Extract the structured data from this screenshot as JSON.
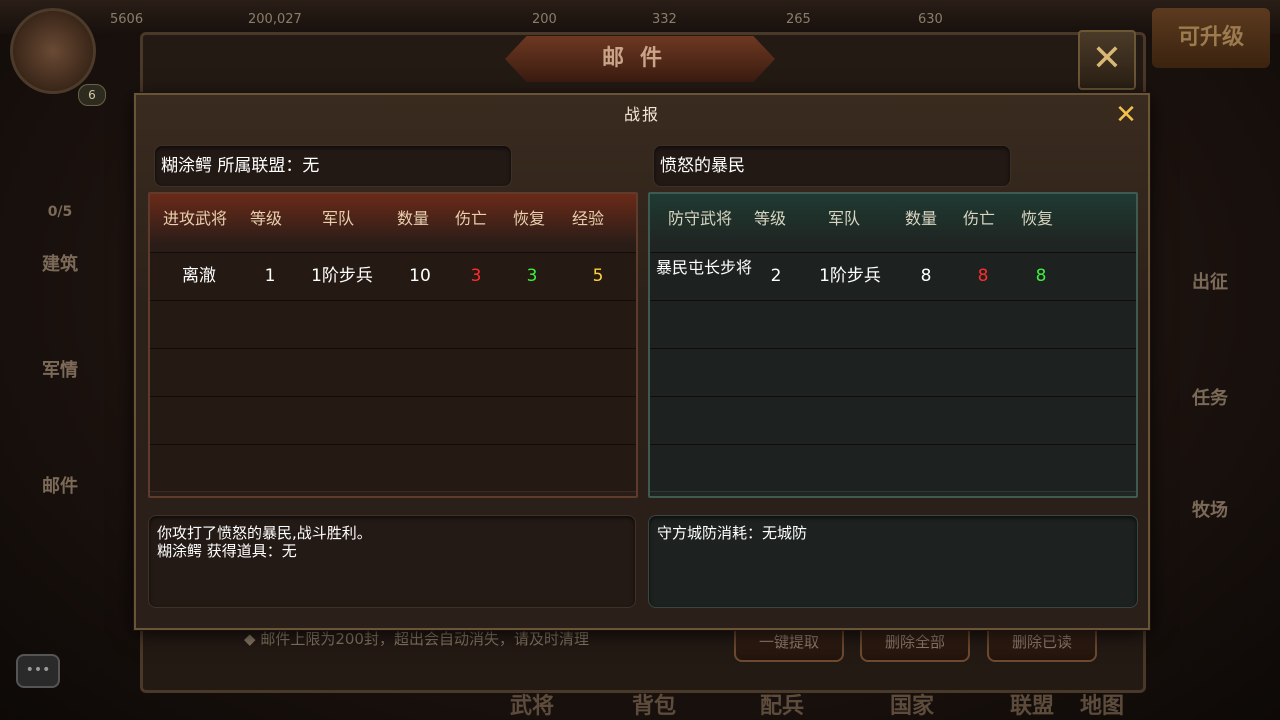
{
  "background": {
    "resources": [
      "5606",
      "200,027",
      "200",
      "332",
      "265",
      "630"
    ],
    "level": "6",
    "side_left": [
      "0/5",
      "建筑",
      "军情",
      "邮件"
    ],
    "side_right": [
      "出征",
      "任务",
      "牧场"
    ],
    "upgrade_button": "可升级",
    "mail_title": "邮件",
    "mail_footer_note": "邮件上限为200封，超出会自动消失，请及时清理",
    "mail_buttons": [
      "一键提取",
      "删除全部",
      "删除已读"
    ],
    "bottom_nav": [
      "武将",
      "背包",
      "配兵",
      "国家",
      "联盟",
      "地图"
    ]
  },
  "dialog": {
    "title": "战报",
    "attacker_name": "糊涂鳄 所属联盟：无",
    "defender_name": "愤怒的暴民",
    "attacker_table": {
      "headers": [
        "进攻武将",
        "等级",
        "军队",
        "数量",
        "伤亡",
        "恢复",
        "经验"
      ],
      "rows": [
        {
          "general": "离澈",
          "level": "1",
          "troop": "1阶步兵",
          "count": "10",
          "casualties": "3",
          "recovered": "3",
          "exp": "5"
        }
      ]
    },
    "defender_table": {
      "headers": [
        "防守武将",
        "等级",
        "军队",
        "数量",
        "伤亡",
        "恢复"
      ],
      "rows": [
        {
          "general": "暴民屯长步将",
          "level": "2",
          "troop": "1阶步兵",
          "count": "8",
          "casualties": "8",
          "recovered": "8"
        }
      ]
    },
    "attacker_summary": [
      "你攻打了愤怒的暴民,战斗胜利。",
      "糊涂鳄 获得道具：无"
    ],
    "defender_summary": "守方城防消耗：无城防"
  },
  "colors": {
    "casualties": "#ff2c2c",
    "recovered": "#3cf03c",
    "experience": "#ffd23a",
    "close_icon": "#f2c24a"
  }
}
